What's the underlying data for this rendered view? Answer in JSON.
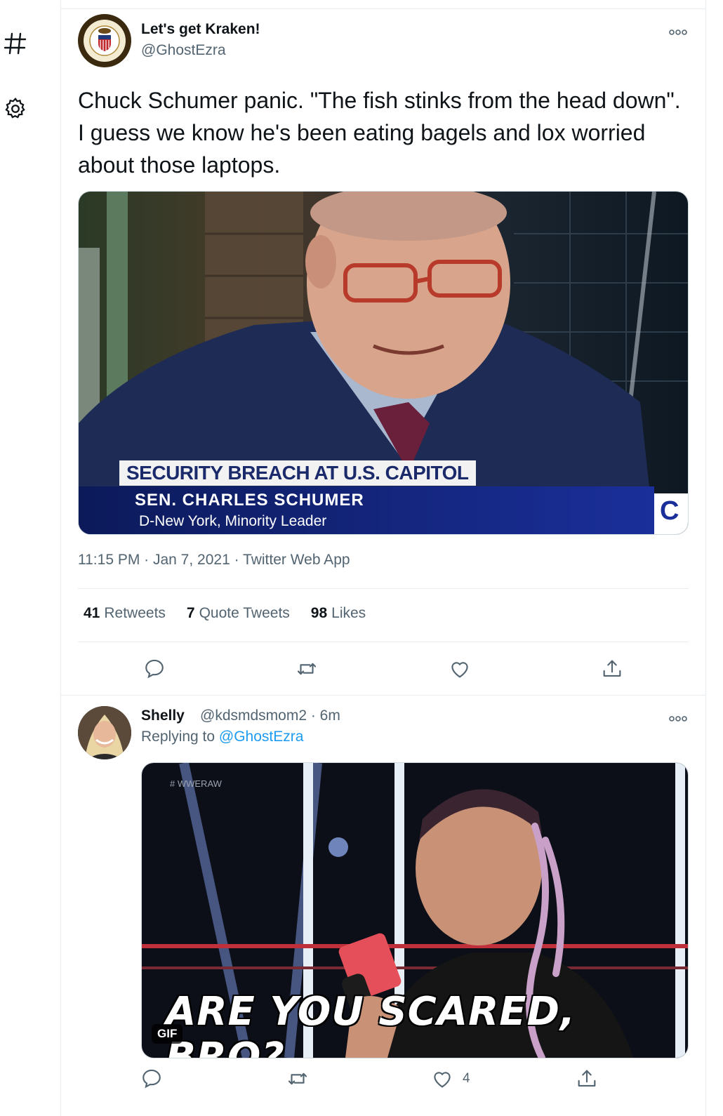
{
  "nav": {
    "icons": [
      "hashtag-icon",
      "settings-gear-icon"
    ],
    "hashtag_glyph": "#"
  },
  "main_tweet": {
    "author_name": "Let's get Kraken!",
    "author_handle": "@GhostEzra",
    "text": "Chuck Schumer panic. \"The fish stinks from the head down\". I guess we know he's been eating bagels and lox worried about those laptops.",
    "media": {
      "caption_headline": "SECURITY BREACH AT U.S. CAPITOL",
      "caption_name": "SEN. CHARLES SCHUMER",
      "caption_title": "D-New York, Minority Leader",
      "caption_logo_letter": "C"
    },
    "timestamp": "11:15 PM · Jan 7, 2021 · Twitter Web App",
    "stats": {
      "retweets_count": "41",
      "retweets_label": "Retweets",
      "quotes_count": "7",
      "quotes_label": "Quote Tweets",
      "likes_count": "98",
      "likes_label": "Likes"
    }
  },
  "reply_tweet": {
    "author_name": "Shelly",
    "author_handle_time": "@kdsmdsmom2 · 6m",
    "replying_prefix": "Replying to",
    "replying_handle": "@GhostEzra",
    "media": {
      "tag": "# WWERAW",
      "caption": "ARE YOU SCARED, BRO?",
      "badge": "GIF"
    },
    "like_count": "4"
  },
  "colors": {
    "accent": "#1d9bf0",
    "secondary_text": "#536471",
    "border": "#e6ecf0"
  }
}
